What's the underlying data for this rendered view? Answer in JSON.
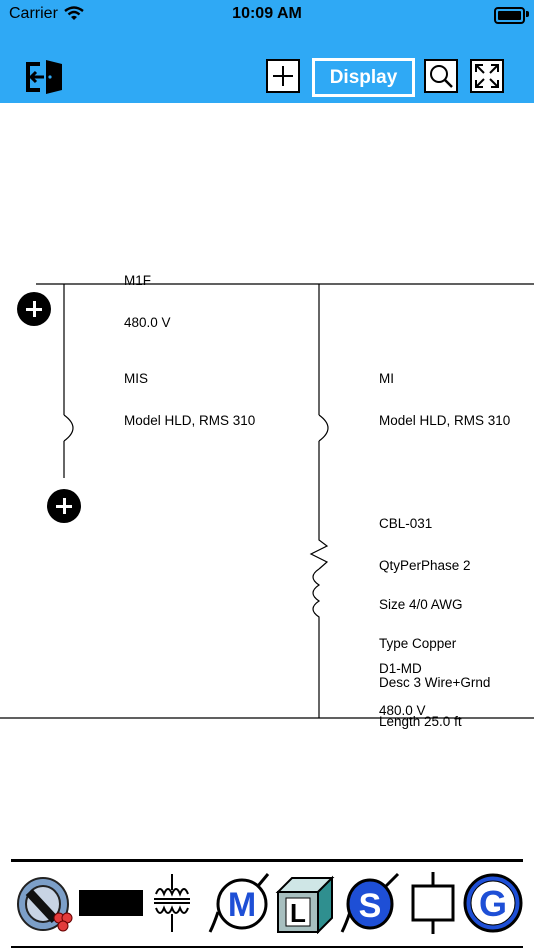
{
  "status_bar": {
    "carrier": "Carrier",
    "time": "10:09 AM"
  },
  "toolbar": {
    "display_label": "Display",
    "icons": [
      "exit-door-icon",
      "plus-icon",
      "search-icon",
      "expand-icon"
    ],
    "background_color": "#2fa9f5"
  },
  "diagram": {
    "bus_top": {
      "name": "M1F",
      "voltage": "480.0 V"
    },
    "left_branch": {
      "name": "MIS",
      "detail": "Model HLD, RMS 310"
    },
    "right_branch": {
      "name": "MI",
      "detail": "Model HLD, RMS 310"
    },
    "cable": {
      "id": "CBL-031",
      "qty": "QtyPerPhase 2",
      "size": "Size 4/0 AWG",
      "type": "Type Copper",
      "desc": "Desc 3 Wire+Grnd",
      "length": "Length 25.0 ft"
    },
    "bus_bottom": {
      "name": "D1-MD",
      "voltage": "480.0 V"
    }
  },
  "palette": {
    "items": [
      {
        "name": "cable-tool",
        "letter": ""
      },
      {
        "name": "bus-tool",
        "letter": ""
      },
      {
        "name": "transformer-tool",
        "letter": ""
      },
      {
        "name": "motor-tool",
        "letter": "M"
      },
      {
        "name": "load-tool",
        "letter": "L"
      },
      {
        "name": "switch-tool",
        "letter": "S"
      },
      {
        "name": "breaker-tool",
        "letter": ""
      },
      {
        "name": "generator-tool",
        "letter": "G"
      }
    ]
  }
}
